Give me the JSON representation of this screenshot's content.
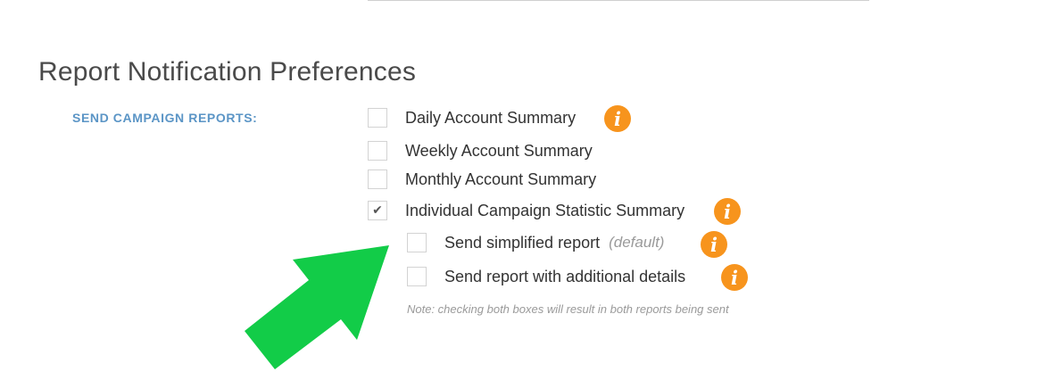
{
  "section": {
    "title": "Report Notification Preferences",
    "field_label": "SEND CAMPAIGN REPORTS:"
  },
  "options": [
    {
      "label": "Daily Account Summary",
      "checked": false,
      "has_info": true
    },
    {
      "label": "Weekly Account Summary",
      "checked": false,
      "has_info": false
    },
    {
      "label": "Monthly Account Summary",
      "checked": false,
      "has_info": false
    },
    {
      "label": "Individual Campaign Statistic Summary",
      "checked": true,
      "has_info": true
    }
  ],
  "sub_options": [
    {
      "label": "Send simplified report",
      "default_tag": "(default)",
      "checked": false,
      "has_info": true
    },
    {
      "label": "Send report with additional details",
      "checked": false,
      "has_info": true
    }
  ],
  "note": "Note: checking both boxes will result in both reports being sent",
  "icons": {
    "check_glyph": "✔",
    "info_glyph": "i"
  },
  "colors": {
    "info_icon": "#f7941d",
    "field_label": "#5b95c6",
    "annotation_arrow": "#12cc48"
  }
}
